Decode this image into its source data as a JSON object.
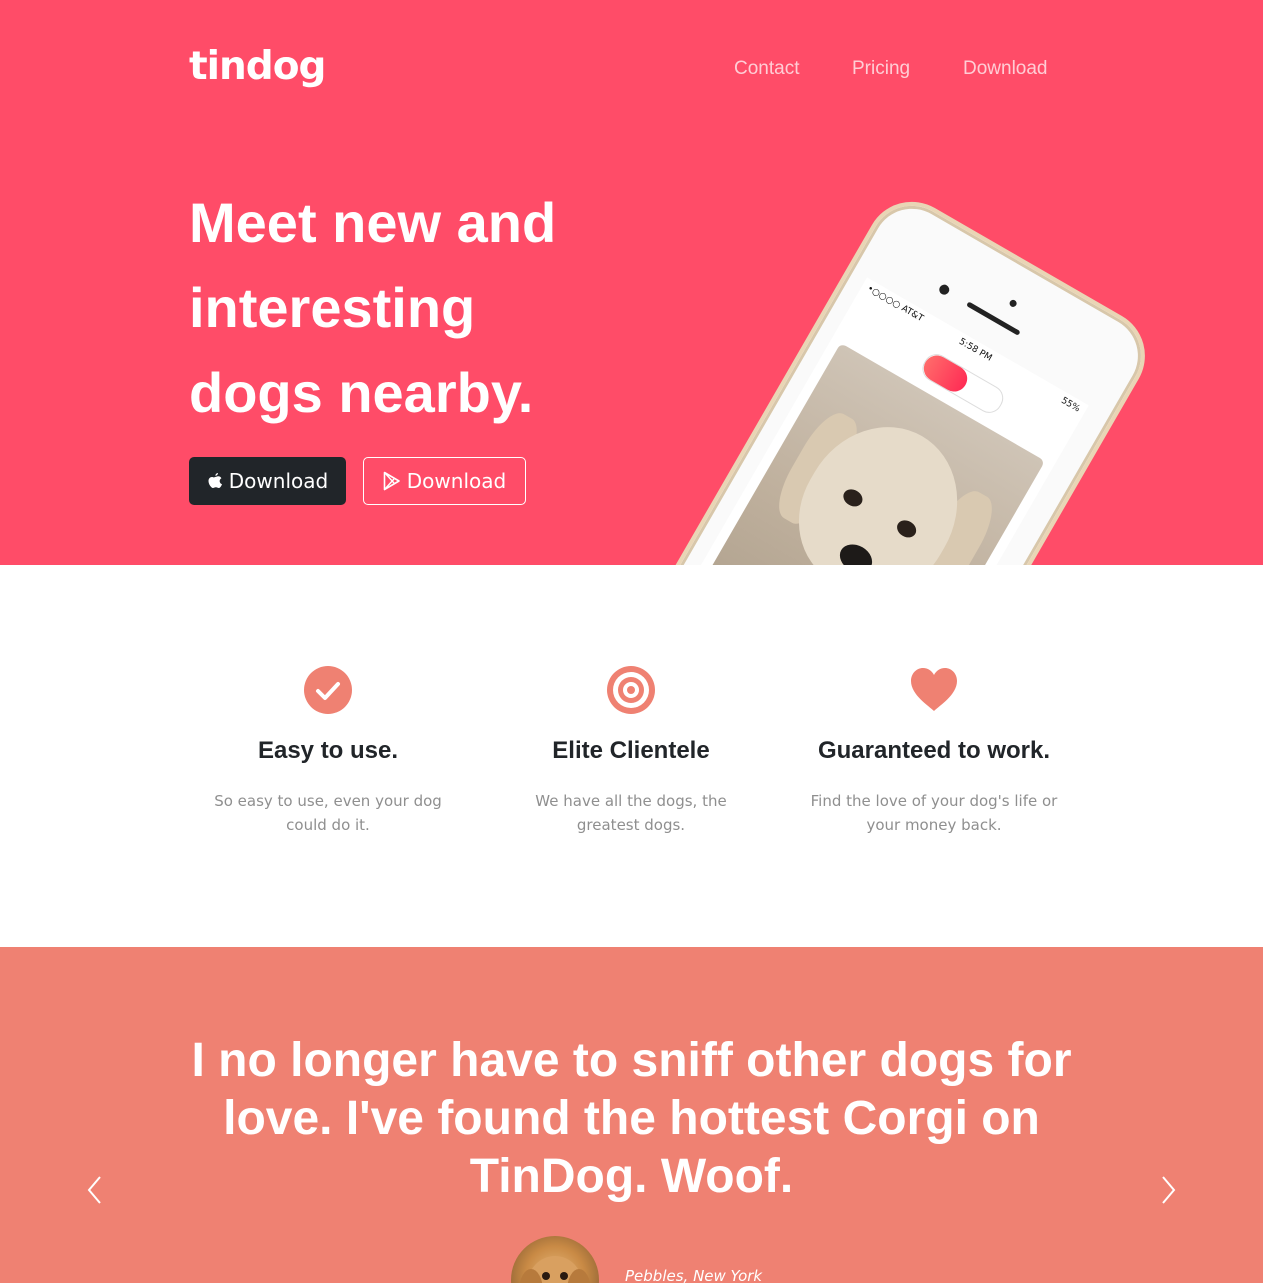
{
  "nav": {
    "brand": "tindog",
    "links": [
      "Contact",
      "Pricing",
      "Download"
    ]
  },
  "hero": {
    "headline_lines": [
      "Meet new and",
      "interesting",
      "dogs nearby."
    ],
    "buttons": [
      {
        "label": "Download",
        "icon": "apple-icon"
      },
      {
        "label": "Download",
        "icon": "google-play-icon"
      }
    ],
    "phone_status": {
      "carrier": "•○○○○ AT&T",
      "time": "5:58 PM",
      "battery": "55%"
    }
  },
  "features": [
    {
      "icon": "check-circle-icon",
      "title": "Easy to use.",
      "text": "So easy to use, even your dog could do it."
    },
    {
      "icon": "bullseye-icon",
      "title": "Elite Clientele",
      "text": "We have all the dogs, the greatest dogs."
    },
    {
      "icon": "heart-icon",
      "title": "Guaranteed to work.",
      "text": "Find the love of your dog's life or your money back."
    }
  ],
  "testimonial": {
    "quote": "I no longer have to sniff other dogs for love. I've found the hottest Corgi on TinDog. Woof.",
    "author": "Pebbles, New York"
  },
  "colors": {
    "hero_bg": "#ff4c68",
    "testimonial_bg": "#ef8172",
    "icon": "#ef8172",
    "dark_button": "#212529"
  }
}
